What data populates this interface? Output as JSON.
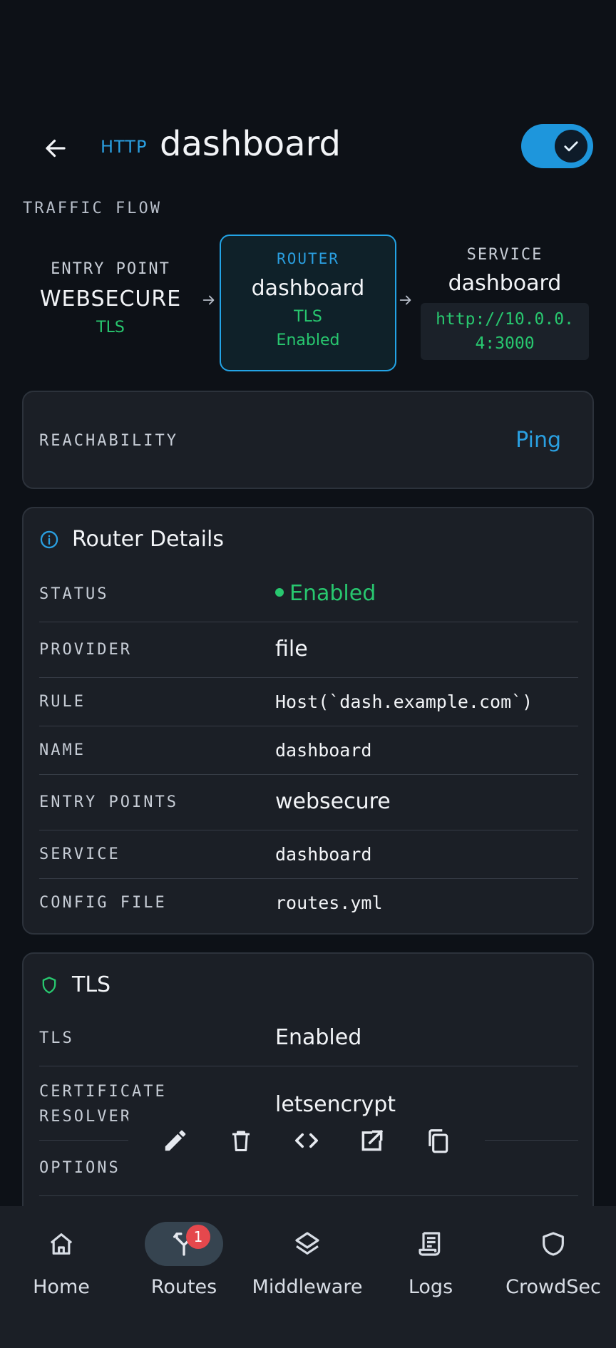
{
  "header": {
    "protocol": "HTTP",
    "title": "dashboard",
    "enabled": true
  },
  "traffic_flow": {
    "label": "TRAFFIC FLOW",
    "entry": {
      "key": "ENTRY POINT",
      "value": "WEBSECURE",
      "tls": "TLS"
    },
    "router": {
      "key": "ROUTER",
      "value": "dashboard",
      "tls": "TLS",
      "status": "Enabled"
    },
    "service": {
      "key": "SERVICE",
      "value": "dashboard",
      "url": "http://10.0.0.4:3000"
    }
  },
  "reachability": {
    "label": "REACHABILITY",
    "action": "Ping"
  },
  "router_details": {
    "title": "Router Details",
    "rows": [
      {
        "key": "STATUS",
        "value": "Enabled"
      },
      {
        "key": "PROVIDER",
        "value": "file"
      },
      {
        "key": "RULE",
        "value": "Host(`dash.example.com`)"
      },
      {
        "key": "NAME",
        "value": "dashboard"
      },
      {
        "key": "ENTRY POINTS",
        "value": "websecure"
      },
      {
        "key": "SERVICE",
        "value": "dashboard"
      },
      {
        "key": "CONFIG FILE",
        "value": "routes.yml"
      }
    ]
  },
  "tls": {
    "title": "TLS",
    "rows": [
      {
        "key": "TLS",
        "value": "Enabled"
      },
      {
        "key": "CERTIFICATE RESOLVER",
        "value": "letsencrypt"
      },
      {
        "key": "OPTIONS",
        "value": ""
      }
    ]
  },
  "nav": {
    "items": [
      {
        "label": "Home",
        "icon": "home-icon"
      },
      {
        "label": "Routes",
        "icon": "routes-icon",
        "badge": "1"
      },
      {
        "label": "Middleware",
        "icon": "layers-icon"
      },
      {
        "label": "Logs",
        "icon": "logs-icon"
      },
      {
        "label": "CrowdSec",
        "icon": "shield-icon"
      }
    ]
  },
  "colors": {
    "accent": "#1e96dc",
    "success": "#28c76f",
    "badge": "#e5484d",
    "background": "#0d1117",
    "card": "#1b1f26"
  }
}
